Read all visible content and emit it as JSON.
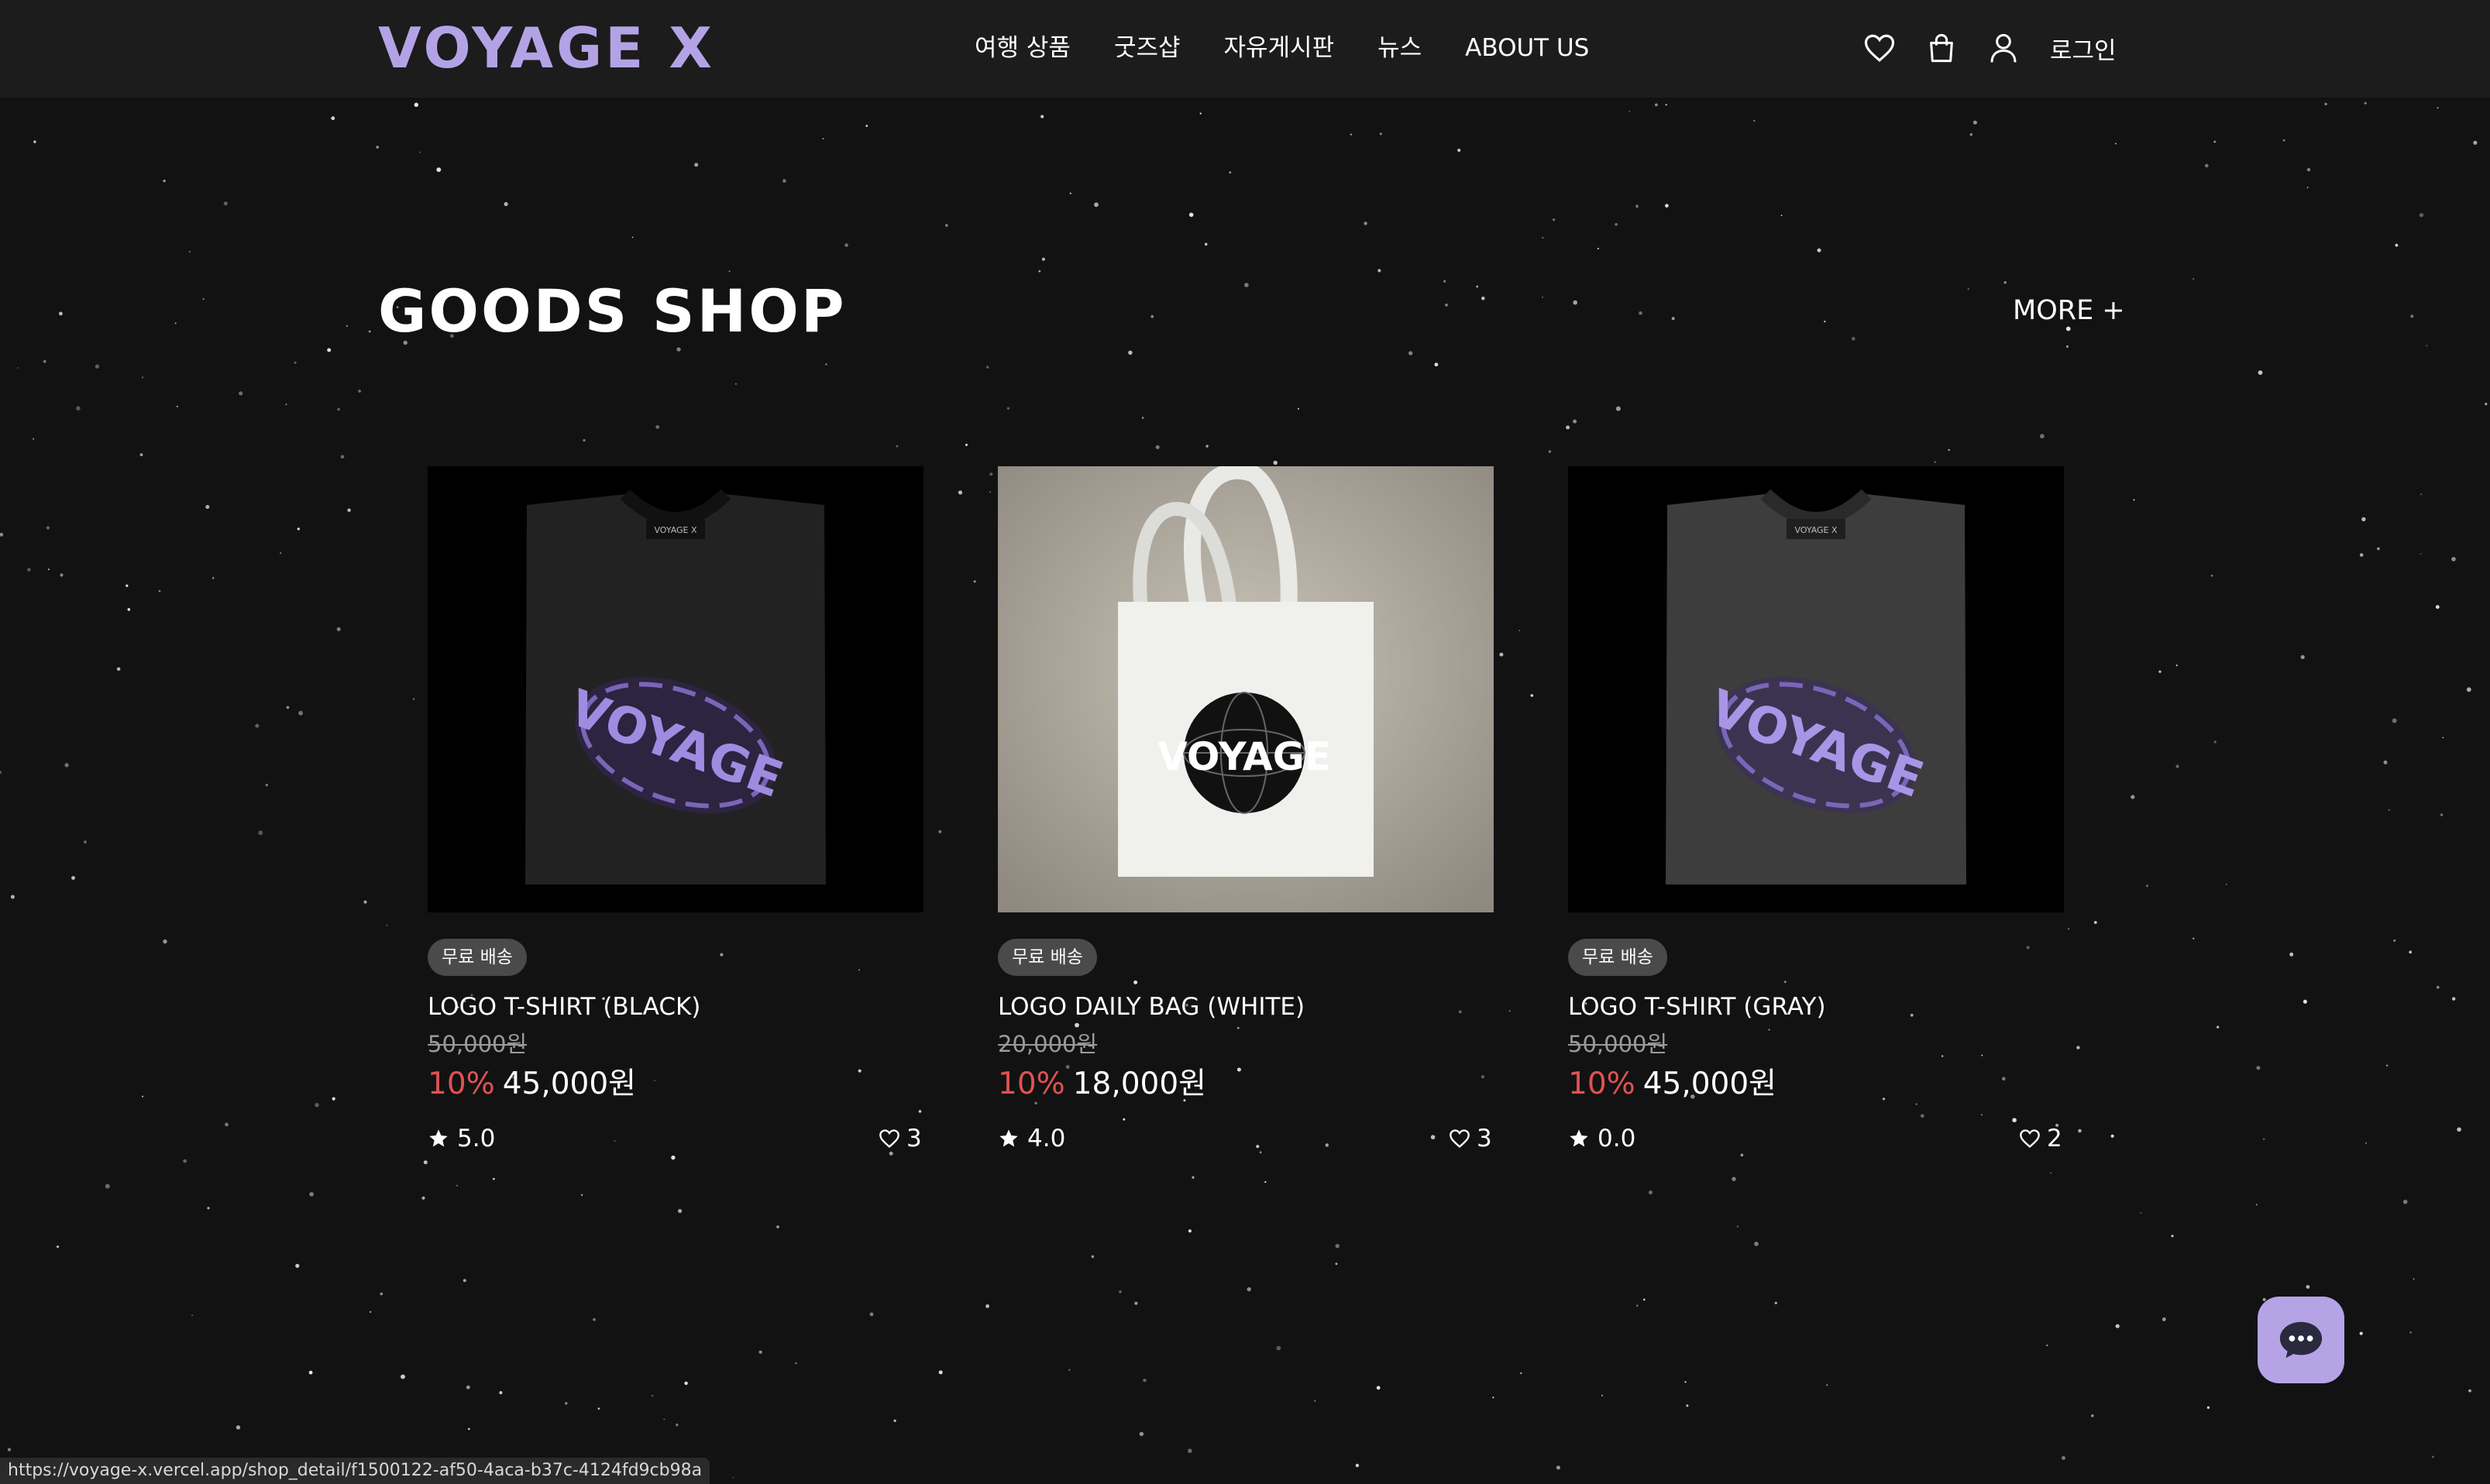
{
  "header": {
    "logo_text": "VOYAGE X",
    "nav": [
      "여행 상품",
      "굿즈샵",
      "자유게시판",
      "뉴스",
      "ABOUT US"
    ],
    "icons": [
      "heart-icon",
      "shopping-bag-icon",
      "user-icon"
    ],
    "login_label": "로그인"
  },
  "section": {
    "title": "GOODS SHOP",
    "more_label": "MORE +"
  },
  "products": [
    {
      "badge": "무료 배송",
      "name": "LOGO T-SHIRT (BLACK)",
      "original_price": "50,000원",
      "discount": "10%",
      "price": "45,000원",
      "rating": "5.0",
      "likes": "3",
      "image": "black-tshirt-image",
      "logo_text": "VOYAGE X"
    },
    {
      "badge": "무료 배송",
      "name": "LOGO DAILY BAG (WHITE)",
      "original_price": "20,000원",
      "discount": "10%",
      "price": "18,000원",
      "rating": "4.0",
      "likes": "3",
      "image": "white-tote-bag-image",
      "logo_text": "VOYAGE"
    },
    {
      "badge": "무료 배송",
      "name": "LOGO T-SHIRT (GRAY)",
      "original_price": "50,000원",
      "discount": "10%",
      "price": "45,000원",
      "rating": "0.0",
      "likes": "2",
      "image": "gray-tshirt-image",
      "logo_text": "VOYAGE X"
    }
  ],
  "chat_button": "chat-icon",
  "status_bar": {
    "url": "https://voyage-x.vercel.app/shop_detail/f1500122-af50-4aca-b37c-4124fd9cb98a"
  },
  "colors": {
    "background": "#121212",
    "header": "#1c1c1c",
    "accent": "#b3a3e6",
    "discount": "#e05252",
    "badge": "#4a4a4a"
  }
}
